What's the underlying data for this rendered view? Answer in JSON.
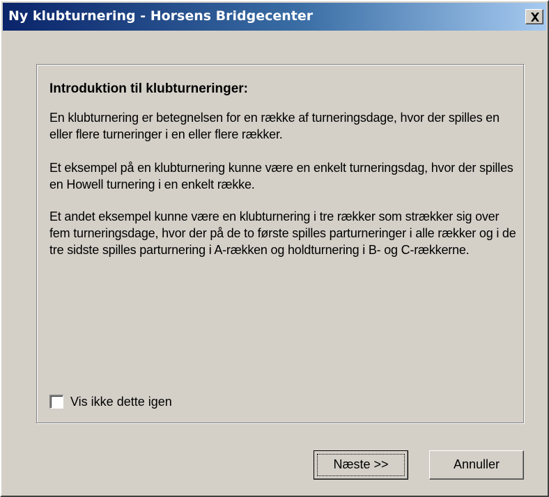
{
  "window": {
    "title": "Ny klubturnering - Horsens Bridgecenter",
    "close_icon": "close-icon"
  },
  "intro": {
    "heading": "Introduktion til klubturneringer:",
    "paragraphs": [
      "En klubturnering er betegnelsen for en række af turneringsdage, hvor der spilles en eller flere turneringer i en eller flere rækker.",
      "Et eksempel på en klubturnering kunne være en enkelt turneringsdag, hvor der spilles en Howell turnering i en enkelt række.",
      "Et andet eksempel kunne være en klubturnering i tre rækker som strækker sig over fem turneringsdage, hvor der på de to første spilles parturneringer i alle rækker og i de tre sidste spilles parturnering i A-rækken og holdturnering i B- og C-rækkerne."
    ]
  },
  "options": {
    "dont_show_again_label": "Vis ikke dette igen",
    "dont_show_again_checked": false
  },
  "buttons": {
    "next_label": "Næste >>",
    "cancel_label": "Annuller"
  }
}
